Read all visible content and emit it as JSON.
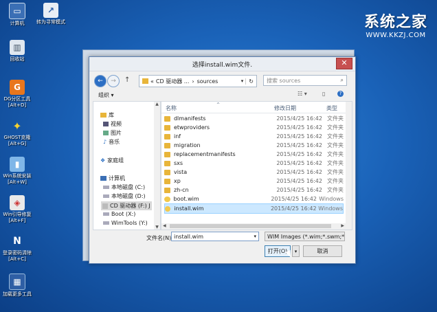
{
  "desktop": {
    "icons": [
      {
        "label": "计算机",
        "icon": "computer-icon"
      },
      {
        "label": "转为寻常模式",
        "icon": "switch-mode-icon"
      },
      {
        "label": "回收站",
        "icon": "recycle-bin-icon"
      },
      {
        "label": "DG分区工具",
        "label2": "[Alt+D]",
        "icon": "diskgenius-icon"
      },
      {
        "label": "GHOST克隆",
        "label2": "[Alt+G]",
        "icon": "ghost-icon"
      },
      {
        "label": "Win系统安装",
        "label2": "[Alt+W]",
        "icon": "win-install-icon"
      },
      {
        "label": "Win引导修复",
        "label2": "[Alt+F]",
        "icon": "boot-repair-icon"
      },
      {
        "label": "登录密码清除",
        "label2": "[Alt+C]",
        "icon": "password-clear-icon"
      },
      {
        "label": "加载更多工具",
        "icon": "more-tools-icon"
      }
    ],
    "brand": {
      "title": "系统之家",
      "url": "WWW.KKZJ.COM"
    }
  },
  "dialog": {
    "title": "选择install.wim文件.",
    "close": "✕",
    "address": {
      "chev": "«",
      "part1": "CD 驱动器 ...",
      "sep": "›",
      "part2": "sources"
    },
    "search_placeholder": "搜索 sources",
    "organize": "组织 ▾",
    "nav": [
      {
        "label": "库",
        "icon": "library-icon"
      },
      {
        "label": "视频",
        "icon": "video-icon"
      },
      {
        "label": "图片",
        "icon": "picture-icon"
      },
      {
        "label": "音乐",
        "icon": "music-icon"
      },
      {
        "label": "家庭组",
        "icon": "homegroup-icon"
      },
      {
        "label": "计算机",
        "icon": "computer-icon"
      },
      {
        "label": "本地磁盘 (C:)",
        "icon": "drive-icon"
      },
      {
        "label": "本地磁盘 (D:)",
        "icon": "drive-icon"
      },
      {
        "label": "CD 驱动器 (F:) J",
        "icon": "cd-drive-icon"
      },
      {
        "label": "Boot (X:)",
        "icon": "drive-icon"
      },
      {
        "label": "WimTools (Y:)",
        "icon": "drive-icon"
      }
    ],
    "columns": {
      "name": "名称",
      "date": "修改日期",
      "type": "类型"
    },
    "files": [
      {
        "name": "dlmanifests",
        "date": "2015/4/25 16:42",
        "type": "文件夹"
      },
      {
        "name": "etwproviders",
        "date": "2015/4/25 16:42",
        "type": "文件夹"
      },
      {
        "name": "inf",
        "date": "2015/4/25 16:42",
        "type": "文件夹"
      },
      {
        "name": "migration",
        "date": "2015/4/25 16:42",
        "type": "文件夹"
      },
      {
        "name": "replacementmanifests",
        "date": "2015/4/25 16:42",
        "type": "文件夹"
      },
      {
        "name": "sxs",
        "date": "2015/4/25 16:42",
        "type": "文件夹"
      },
      {
        "name": "vista",
        "date": "2015/4/25 16:42",
        "type": "文件夹"
      },
      {
        "name": "xp",
        "date": "2015/4/25 16:42",
        "type": "文件夹"
      },
      {
        "name": "zh-cn",
        "date": "2015/4/25 16:42",
        "type": "文件夹"
      },
      {
        "name": "boot.wim",
        "date": "2015/4/25 16:42",
        "type": "Windows"
      },
      {
        "name": "install.wim",
        "date": "2015/4/25 16:42",
        "type": "Windows"
      }
    ],
    "filename_label": "文件名(N):",
    "filename_value": "install.wim",
    "filter": "WIM Images (*.wim;*.swm;*.",
    "open": "打开(O)",
    "cancel": "取消"
  }
}
